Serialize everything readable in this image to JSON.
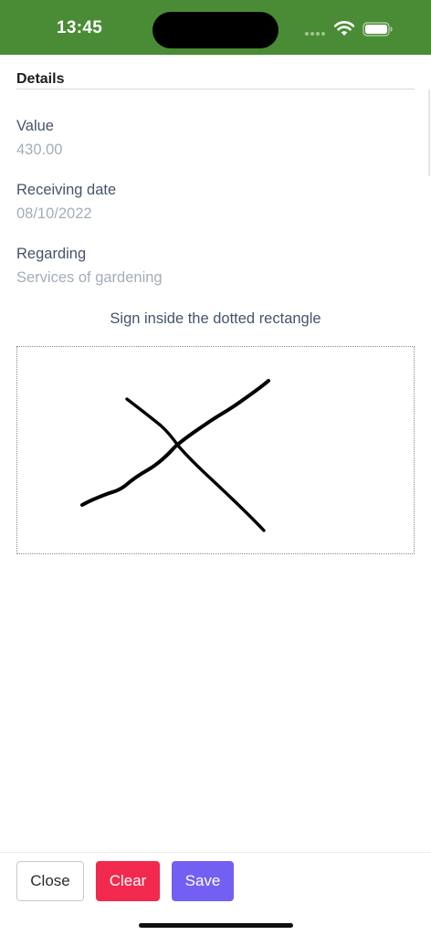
{
  "status_bar": {
    "time": "13:45",
    "background_color": "#4a8c35",
    "icons": [
      "signal-dots-icon",
      "wifi-icon",
      "battery-icon"
    ]
  },
  "details": {
    "title": "Details",
    "fields": [
      {
        "label": "Value",
        "value": "430.00"
      },
      {
        "label": "Receiving date",
        "value": "08/10/2022"
      },
      {
        "label": "Regarding",
        "value": "Services of gardening"
      }
    ]
  },
  "signature": {
    "instruction": "Sign inside the dotted rectangle"
  },
  "footer": {
    "close_label": "Close",
    "clear_label": "Clear",
    "save_label": "Save",
    "clear_color": "#f2294e",
    "save_color": "#7360f2"
  }
}
